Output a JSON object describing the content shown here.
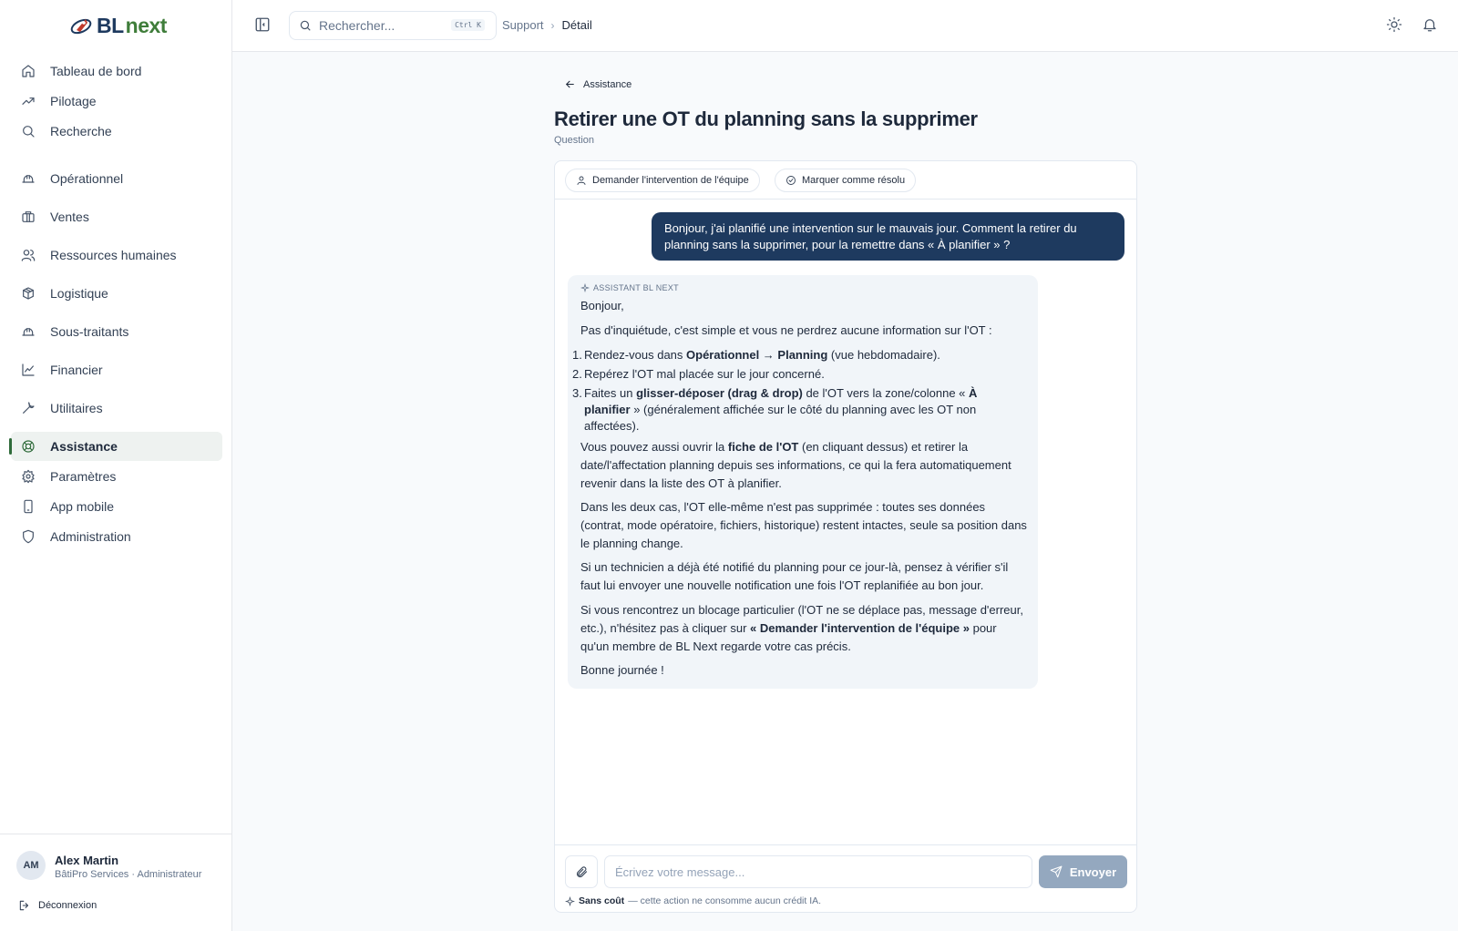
{
  "brand": {
    "name_part1": "BL",
    "name_part2": "next"
  },
  "sidebar": {
    "items": [
      {
        "label": "Tableau de bord",
        "icon": "home-icon"
      },
      {
        "label": "Pilotage",
        "icon": "trend-icon"
      },
      {
        "label": "Recherche",
        "icon": "search-icon"
      },
      {
        "label": "Opérationnel",
        "icon": "helmet-icon"
      },
      {
        "label": "Ventes",
        "icon": "briefcase-icon"
      },
      {
        "label": "Ressources humaines",
        "icon": "users-icon"
      },
      {
        "label": "Logistique",
        "icon": "boxes-icon"
      },
      {
        "label": "Sous-traitants",
        "icon": "helmet-icon"
      },
      {
        "label": "Financier",
        "icon": "chart-line-icon"
      },
      {
        "label": "Utilitaires",
        "icon": "wrench-icon"
      },
      {
        "label": "Assistance",
        "icon": "lifebuoy-icon",
        "active": true
      },
      {
        "label": "Paramètres",
        "icon": "gear-icon"
      },
      {
        "label": "App mobile",
        "icon": "phone-icon"
      },
      {
        "label": "Administration",
        "icon": "shield-icon"
      }
    ]
  },
  "user": {
    "initials": "AM",
    "name": "Alex Martin",
    "role": "BâtiPro Services · Administrateur",
    "logout_label": "Déconnexion"
  },
  "header": {
    "search_placeholder": "Rechercher...",
    "search_shortcut": "Ctrl K",
    "breadcrumb": [
      "Support",
      "Détail"
    ]
  },
  "page": {
    "back_label": "Assistance",
    "title": "Retirer une OT du planning sans la supprimer",
    "subtitle": "Question",
    "actions": {
      "request_team": "Demander l'intervention de l'équipe",
      "mark_resolved": "Marquer comme résolu"
    }
  },
  "conversation": {
    "user_message": "Bonjour, j'ai planifié une intervention sur le mauvais jour. Comment la retirer du planning sans la supprimer, pour la remettre dans « À planifier » ?",
    "assistant_label": "ASSISTANT BL NEXT",
    "greeting": "Bonjour,",
    "intro": "Pas d'inquiétude, c'est simple et vous ne perdrez aucune information sur l'OT :",
    "steps": [
      {
        "pre": "Rendez-vous dans ",
        "bold": "Opérationnel → Planning",
        "post": " (vue hebdomadaire)."
      },
      {
        "pre": "Repérez l'OT mal placée sur le jour concerné.",
        "bold": "",
        "post": ""
      },
      {
        "pre": "Faites un ",
        "bold": "glisser-déposer (drag & drop)",
        "post": " de l'OT vers la zone/colonne « ",
        "bold2": "À planifier",
        "post2": " » (généralement affichée sur le côté du planning avec les OT non affectées)."
      }
    ],
    "para_alt": {
      "pre": "Vous pouvez aussi ouvrir la ",
      "bold": "fiche de l'OT",
      "post": " (en cliquant dessus) et retirer la date/l'affectation planning depuis ses informations, ce qui la fera automatiquement revenir dans la liste des OT à planifier."
    },
    "para_both": "Dans les deux cas, l'OT elle-même n'est pas supprimée : toutes ses données (contrat, mode opératoire, fichiers, historique) restent intactes, seule sa position dans le planning change.",
    "para_tech": "Si un technicien a déjà été notifié du planning pour ce jour-là, pensez à vérifier s'il faut lui envoyer une nouvelle notification une fois l'OT replanifiée au bon jour.",
    "para_block": {
      "pre": "Si vous rencontrez un blocage particulier (l'OT ne se déplace pas, message d'erreur, etc.), n'hésitez pas à cliquer sur ",
      "bold": "« Demander l'intervention de l'équipe »",
      "post": " pour qu'un membre de BL Next regarde votre cas précis."
    },
    "closing": "Bonne journée !"
  },
  "composer": {
    "placeholder": "Écrivez votre message...",
    "send_label": "Envoyer",
    "cost_bold": "Sans coût",
    "cost_text": " — cette action ne consomme aucun crédit IA."
  },
  "colors": {
    "primary": "#1e3a5f",
    "brand_green": "#3f7d3a",
    "send_disabled": "#94a8bf"
  }
}
